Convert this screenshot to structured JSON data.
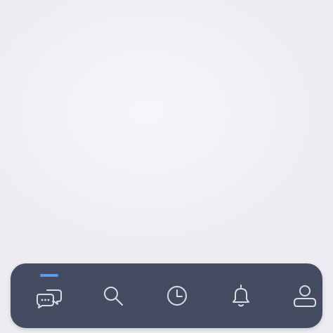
{
  "screen": {
    "background_color": "#f1f1f6"
  },
  "tab_bar": {
    "background_color": "#454c61",
    "icon_color": "#d9dbe3",
    "active_indicator_color": "#5f9bea",
    "active_tab": "messages",
    "tabs": [
      {
        "id": "messages",
        "icon": "chat-bubbles-icon",
        "active": true
      },
      {
        "id": "search",
        "icon": "search-icon",
        "active": false
      },
      {
        "id": "history",
        "icon": "clock-icon",
        "active": false
      },
      {
        "id": "notifications",
        "icon": "bell-icon",
        "active": false
      },
      {
        "id": "profile",
        "icon": "user-icon",
        "active": false
      }
    ]
  }
}
